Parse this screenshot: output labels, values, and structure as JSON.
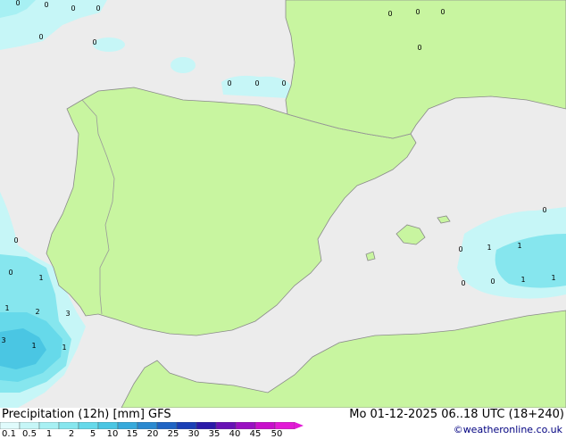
{
  "title": {
    "left": "Precipitation (12h) [mm] GFS",
    "right": "Mo 01-12-2025 06..18 UTC (18+240)"
  },
  "credit": "©weatheronline.co.uk",
  "legend": {
    "ticks": [
      "0.1",
      "0.5",
      "1",
      "2",
      "5",
      "10",
      "15",
      "20",
      "25",
      "30",
      "35",
      "40",
      "45",
      "50"
    ],
    "colors": [
      "#e0fbfc",
      "#c6f6f7",
      "#a7f0f3",
      "#86e6ee",
      "#66d9ea",
      "#4ac6e3",
      "#36a9db",
      "#2a89d0",
      "#1f64c4",
      "#1a3fb6",
      "#2a1aa8",
      "#6812b5",
      "#9a10c2",
      "#c80fcb",
      "#e21ad6"
    ]
  },
  "map": {
    "colors": {
      "sea": "#ececec",
      "land": "#c8f5a0",
      "border": "#999999",
      "coast": "#8a8a8a"
    },
    "labels": [
      "0",
      "0",
      "0",
      "0",
      "0",
      "0",
      "0",
      "0",
      "0",
      "0",
      "0",
      "0",
      "0",
      "0",
      "0",
      "1",
      "0",
      "1",
      "1",
      "1",
      "0",
      "0",
      "0",
      "1",
      "2",
      "1",
      "3",
      "3",
      "1",
      "1"
    ]
  }
}
